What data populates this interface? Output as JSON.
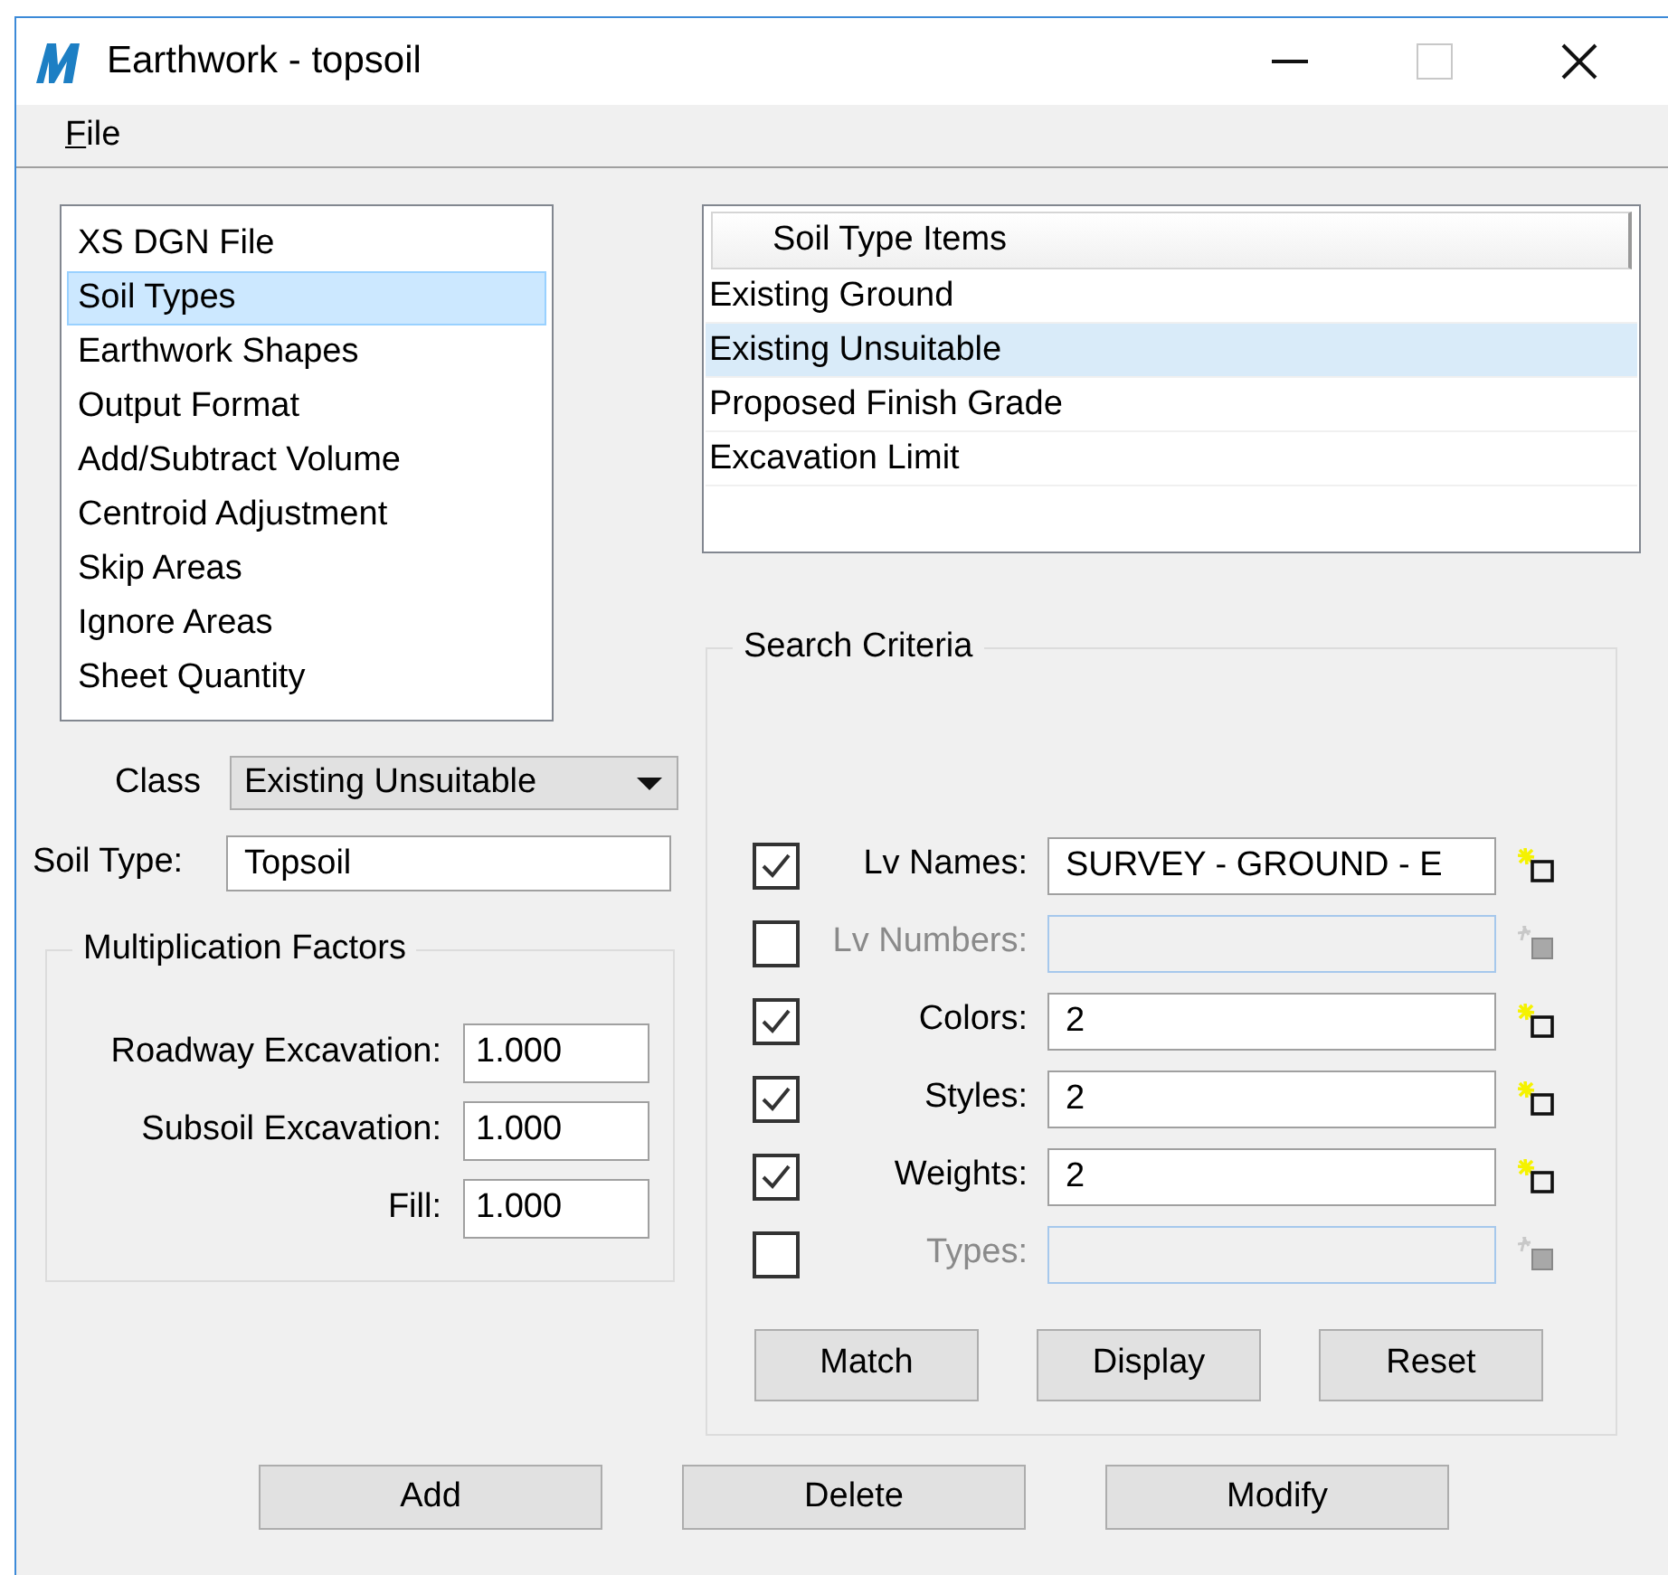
{
  "window": {
    "title": "Earthwork - topsoil"
  },
  "menu": [
    {
      "label": "File",
      "mnemonic_underlined": true
    }
  ],
  "categories": [
    {
      "label": "XS DGN File",
      "selected": false
    },
    {
      "label": "Soil Types",
      "selected": true
    },
    {
      "label": "Earthwork Shapes",
      "selected": false
    },
    {
      "label": "Output Format",
      "selected": false
    },
    {
      "label": "Add/Subtract Volume",
      "selected": false
    },
    {
      "label": "Centroid Adjustment",
      "selected": false
    },
    {
      "label": "Skip Areas",
      "selected": false
    },
    {
      "label": "Ignore Areas",
      "selected": false
    },
    {
      "label": "Sheet Quantity",
      "selected": false
    }
  ],
  "class_field": {
    "label": "Class",
    "value": "Existing Unsuitable"
  },
  "soil_type": {
    "label": "Soil Type:",
    "value": "Topsoil"
  },
  "multiplication_factors": {
    "title": "Multiplication Factors",
    "rows": [
      {
        "label": "Roadway Excavation:",
        "value": "1.000"
      },
      {
        "label": "Subsoil Excavation:",
        "value": "1.000"
      },
      {
        "label": "Fill:",
        "value": "1.000"
      }
    ]
  },
  "soil_type_items": {
    "header": "Soil Type Items",
    "rows": [
      {
        "label": "Existing Ground",
        "selected": false
      },
      {
        "label": "Existing Unsuitable",
        "selected": true
      },
      {
        "label": "Proposed Finish Grade",
        "selected": false
      },
      {
        "label": "Excavation Limit",
        "selected": false
      }
    ]
  },
  "search_criteria": {
    "title": "Search Criteria",
    "rows": [
      {
        "label": "Lv Names:",
        "value": "SURVEY - GROUND - E",
        "checked": true,
        "disabled": false
      },
      {
        "label": "Lv Numbers:",
        "checked": false,
        "disabled": true
      },
      {
        "label": "Colors:",
        "value": "2",
        "checked": true,
        "disabled": false
      },
      {
        "label": "Styles:",
        "value": "2",
        "checked": true,
        "disabled": false
      },
      {
        "label": "Weights:",
        "value": "2",
        "checked": true,
        "disabled": false
      },
      {
        "label": "Types:",
        "checked": false,
        "disabled": true
      }
    ],
    "buttons": [
      "Match",
      "Display",
      "Reset"
    ]
  },
  "buttons": [
    "Add",
    "Delete",
    "Modify"
  ]
}
